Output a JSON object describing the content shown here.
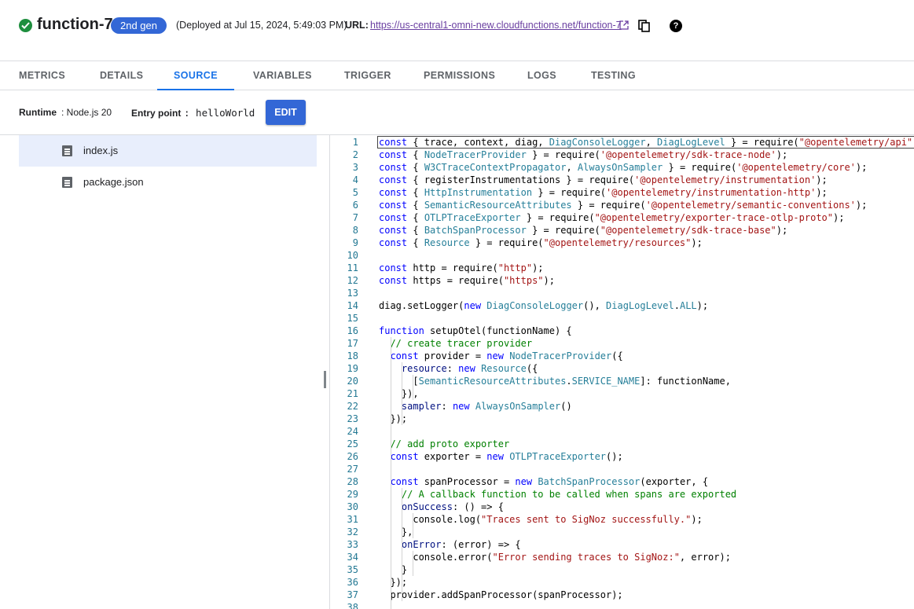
{
  "header": {
    "function_name": "function-7",
    "gen_badge": "2nd gen",
    "deployed": "(Deployed at Jul 15, 2024, 5:49:03 PM)",
    "url_label": "URL:",
    "url": "https://us-central1-omni-new.cloudfunctions.net/function-7",
    "help_glyph": "?"
  },
  "tabs": [
    {
      "label": "METRICS"
    },
    {
      "label": "DETAILS"
    },
    {
      "label": "SOURCE"
    },
    {
      "label": "VARIABLES"
    },
    {
      "label": "TRIGGER"
    },
    {
      "label": "PERMISSIONS"
    },
    {
      "label": "LOGS"
    },
    {
      "label": "TESTING"
    }
  ],
  "active_tab": "SOURCE",
  "info": {
    "runtime_label": "Runtime",
    "runtime_value": ": Node.js 20",
    "entry_label": "Entry point",
    "entry_value": ": helloWorld",
    "edit_label": "EDIT"
  },
  "files": [
    {
      "name": "index.js",
      "selected": true
    },
    {
      "name": "package.json",
      "selected": false
    }
  ],
  "code": {
    "start_line": 1,
    "lines": [
      "const { trace, context, diag, DiagConsoleLogger, DiagLogLevel } = require(\"@opentelemetry/api\");",
      "const { NodeTracerProvider } = require('@opentelemetry/sdk-trace-node');",
      "const { W3CTraceContextPropagator, AlwaysOnSampler } = require('@opentelemetry/core');",
      "const { registerInstrumentations } = require('@opentelemetry/instrumentation');",
      "const { HttpInstrumentation } = require('@opentelemetry/instrumentation-http');",
      "const { SemanticResourceAttributes } = require('@opentelemetry/semantic-conventions');",
      "const { OTLPTraceExporter } = require(\"@opentelemetry/exporter-trace-otlp-proto\");",
      "const { BatchSpanProcessor } = require(\"@opentelemetry/sdk-trace-base\");",
      "const { Resource } = require(\"@opentelemetry/resources\");",
      "",
      "const http = require(\"http\");",
      "const https = require(\"https\");",
      "",
      "diag.setLogger(new DiagConsoleLogger(), DiagLogLevel.ALL);",
      "",
      "function setupOtel(functionName) {",
      "  // create tracer provider",
      "  const provider = new NodeTracerProvider({",
      "    resource: new Resource({",
      "      [SemanticResourceAttributes.SERVICE_NAME]: functionName,",
      "    }),",
      "    sampler: new AlwaysOnSampler()",
      "  });",
      "",
      "  // add proto exporter",
      "  const exporter = new OTLPTraceExporter();",
      "",
      "  const spanProcessor = new BatchSpanProcessor(exporter, {",
      "    // A callback function to be called when spans are exported",
      "    onSuccess: () => {",
      "      console.log(\"Traces sent to SigNoz successfully.\");",
      "    },",
      "    onError: (error) => {",
      "      console.error(\"Error sending traces to SigNoz:\", error);",
      "    }",
      "  });",
      "  provider.addSpanProcessor(spanProcessor);",
      ""
    ]
  },
  "colors": {
    "accent": "#1a73e8",
    "button": "#3367d6",
    "success": "#1e8e3e",
    "link": "#6a3fa1",
    "keyword": "#0000ff",
    "type": "#267f99",
    "string": "#a31515",
    "comment": "#008000",
    "line_number": "#237893"
  },
  "icons": {
    "status": "check-circle-icon",
    "external": "external-link-icon",
    "copy": "copy-icon",
    "help": "help-icon",
    "file": "file-icon"
  }
}
